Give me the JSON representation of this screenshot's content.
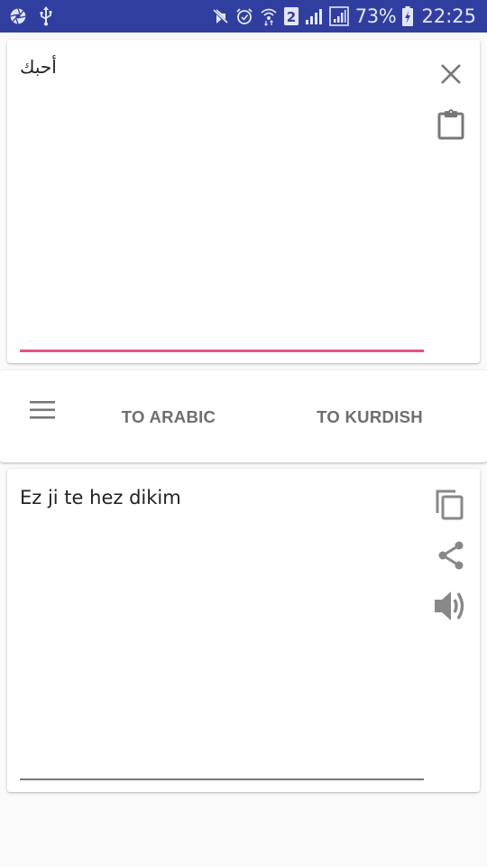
{
  "status_bar": {
    "left_icons": [
      "camera-aperture-icon",
      "usb-icon"
    ],
    "right_icons": [
      "mute-icon",
      "alarm-icon",
      "wifi-icon",
      "sim2-icon",
      "signal-icon",
      "signal-boxed-icon"
    ],
    "sim_label": "2",
    "battery_percent": "73%",
    "battery_icon": "battery-charging-icon",
    "time": "22:25",
    "background_color": "#303f9f"
  },
  "input_panel": {
    "source_text": "أحبك",
    "clear_icon": "close-icon",
    "paste_icon": "clipboard-icon",
    "underline_color": "#e8508a"
  },
  "toolbar": {
    "menu_icon": "hamburger-menu-icon",
    "tabs": [
      {
        "label": "TO ARABIC"
      },
      {
        "label": "TO KURDISH"
      }
    ]
  },
  "output_panel": {
    "translated_text": "Ez ji te hez dikim",
    "copy_icon": "copy-icon",
    "share_icon": "share-icon",
    "speak_icon": "volume-icon"
  }
}
